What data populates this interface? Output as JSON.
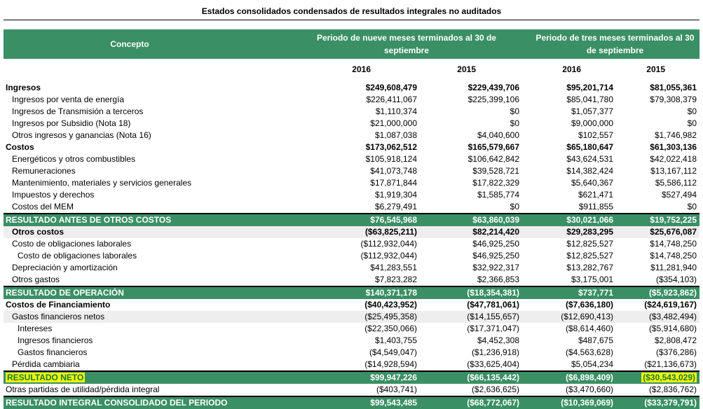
{
  "title": "Estados consolidados condensados de resultados integrales no auditados",
  "header": {
    "concept": "Concepto",
    "period9": "Periodo de nueve meses terminados al 30 de septiembre",
    "period3": "Periodo de tres meses terminados al 30 de septiembre"
  },
  "years": [
    "2016",
    "2015",
    "2016",
    "2015"
  ],
  "rows": [
    {
      "label": "Ingresos",
      "style": "bold",
      "indent": 0,
      "v": [
        "$249,608,479",
        "$229,439,706",
        "$95,201,714",
        "$81,055,361"
      ]
    },
    {
      "label": "Ingresos por venta de energía",
      "style": "",
      "indent": 1,
      "v": [
        "$226,411,067",
        "$225,399,106",
        "$85,041,780",
        "$79,308,379"
      ]
    },
    {
      "label": "Ingresos de Transmisión a terceros",
      "style": "",
      "indent": 1,
      "v": [
        "$1,110,374",
        "$0",
        "$1,057,377",
        "$0"
      ]
    },
    {
      "label": "Ingresos por Subsidio (Nota 18)",
      "style": "",
      "indent": 1,
      "v": [
        "$21,000,000",
        "$0",
        "$9,000,000",
        "$0"
      ]
    },
    {
      "label": "Otros ingresos y ganancias (Nota 16)",
      "style": "",
      "indent": 1,
      "v": [
        "$1,087,038",
        "$4,040,600",
        "$102,557",
        "$1,746,982"
      ]
    },
    {
      "label": "Costos",
      "style": "bold",
      "indent": 0,
      "v": [
        "$173,062,512",
        "$165,579,667",
        "$65,180,647",
        "$61,303,136"
      ]
    },
    {
      "label": "Energéticos y otros combustibles",
      "style": "",
      "indent": 1,
      "v": [
        "$105,918,124",
        "$106,642,842",
        "$43,624,531",
        "$42,022,418"
      ]
    },
    {
      "label": "Remuneraciones",
      "style": "",
      "indent": 1,
      "v": [
        "$41,073,748",
        "$39,528,721",
        "$14,382,424",
        "$13,167,112"
      ]
    },
    {
      "label": "Mantenimiento, materiales y servicios generales",
      "style": "",
      "indent": 1,
      "v": [
        "$17,871,844",
        "$17,822,329",
        "$5,640,367",
        "$5,586,112"
      ]
    },
    {
      "label": "Impuestos y derechos",
      "style": "",
      "indent": 1,
      "v": [
        "$1,919,304",
        "$1,585,774",
        "$621,471",
        "$527,494"
      ]
    },
    {
      "label": "Costos del MEM",
      "style": "",
      "indent": 1,
      "v": [
        "$6,279,491",
        "$0",
        "$911,855",
        "$0"
      ]
    },
    {
      "label": "RESULTADO ANTES DE OTROS COSTOS",
      "style": "green",
      "indent": 0,
      "v": [
        "$76,545,968",
        "$63,860,039",
        "$30,021,066",
        "$19,752,225"
      ]
    },
    {
      "label": "Otros costos",
      "style": "bold shade",
      "indent": 1,
      "v": [
        "($63,825,211)",
        "$82,214,420",
        "$29,283,295",
        "$25,676,087"
      ]
    },
    {
      "label": "Costo de obligaciones laborales",
      "style": "",
      "indent": 1,
      "v": [
        "($112,932,044)",
        "$46,925,250",
        "$12,825,527",
        "$14,748,250"
      ]
    },
    {
      "label": "Costo de obligaciones laborales",
      "style": "",
      "indent": 2,
      "v": [
        "($112,932,044)",
        "$46,925,250",
        "$12,825,527",
        "$14,748,250"
      ]
    },
    {
      "label": "Depreciación y amortización",
      "style": "",
      "indent": 1,
      "v": [
        "$41,283,551",
        "$32,922,317",
        "$13,282,767",
        "$11,281,940"
      ]
    },
    {
      "label": "Otros gastos",
      "style": "",
      "indent": 1,
      "v": [
        "$7,823,282",
        "$2,366,853",
        "$3,175,001",
        "($354,103)"
      ]
    },
    {
      "label": "RESULTADO DE OPERACIÓN",
      "style": "green",
      "indent": 0,
      "v": [
        "$140,371,178",
        "($18,354,381)",
        "$737,771",
        "($5,923,862)"
      ]
    },
    {
      "label": "Costos de Financiamiento",
      "style": "bold",
      "indent": 0,
      "v": [
        "($40,423,952)",
        "($47,781,061)",
        "($7,636,180)",
        "($24,619,167)"
      ]
    },
    {
      "label": "Gastos financieros netos",
      "style": "shade",
      "indent": 1,
      "v": [
        "($25,495,358)",
        "($14,155,657)",
        "($12,690,413)",
        "($3,482,494)"
      ]
    },
    {
      "label": "Intereses",
      "style": "",
      "indent": 2,
      "v": [
        "($22,350,066)",
        "($17,371,047)",
        "($8,614,460)",
        "($5,914,680)"
      ]
    },
    {
      "label": "Ingresos financieros",
      "style": "",
      "indent": 2,
      "v": [
        "$1,403,755",
        "$4,452,308",
        "$487,675",
        "$2,808,472"
      ]
    },
    {
      "label": "Gastos financieros",
      "style": "",
      "indent": 2,
      "v": [
        "($4,549,047)",
        "($1,236,918)",
        "($4,563,628)",
        "($376,286)"
      ]
    },
    {
      "label": "Pérdida cambiaria",
      "style": "",
      "indent": 1,
      "v": [
        "($14,928,594)",
        "($33,625,404)",
        "$5,054,234",
        "($21,136,673)"
      ]
    },
    {
      "label": "RESULTADO NETO",
      "style": "green",
      "indent": 0,
      "highlight": [
        true,
        false,
        false,
        false,
        true,
        false
      ],
      "v": [
        "$99,947,226",
        "($66,135,442)",
        "($6,898,409)",
        "($30,543,029)"
      ]
    },
    {
      "label": "Otras partidas de utilidad/pérdida integral",
      "style": "",
      "indent": 0,
      "v": [
        "($403,741)",
        "($2,636,625)",
        "($3,470,660)",
        "($2,836,762)"
      ]
    },
    {
      "label": "RESULTADO INTEGRAL CONSOLIDADO DEL PERIODO",
      "style": "green",
      "indent": 0,
      "v": [
        "$99,543,485",
        "($68,772,067)",
        "($10,369,069)",
        "($33,379,791)"
      ]
    }
  ],
  "colors": {
    "header_green": "#3a8f65",
    "highlight": "#f5f500"
  }
}
